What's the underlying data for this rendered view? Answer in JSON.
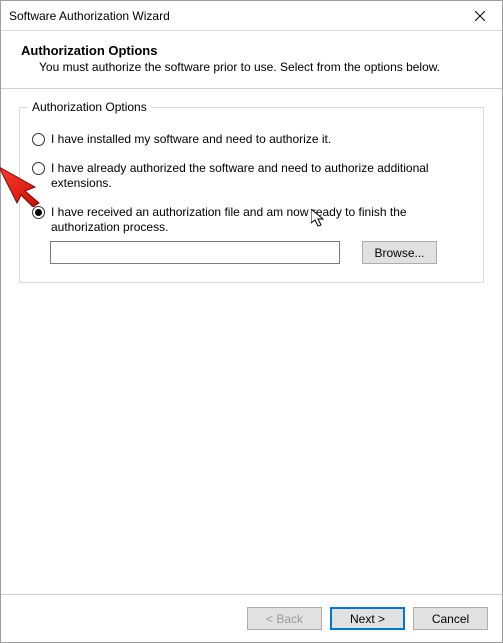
{
  "window": {
    "title": "Software Authorization Wizard"
  },
  "header": {
    "title": "Authorization Options",
    "subtitle": "You must authorize the software prior to use. Select from the options below."
  },
  "group": {
    "legend": "Authorization Options",
    "options": [
      {
        "label": "I have installed my software and need to authorize it.",
        "selected": false
      },
      {
        "label": "I have already authorized the software and need to authorize additional extensions.",
        "selected": false
      },
      {
        "label": "I have received an authorization file and am now ready to finish the authorization process.",
        "selected": true
      }
    ],
    "file_value": "",
    "browse_label": "Browse..."
  },
  "footer": {
    "back_label": "< Back",
    "next_label": "Next >",
    "cancel_label": "Cancel"
  }
}
